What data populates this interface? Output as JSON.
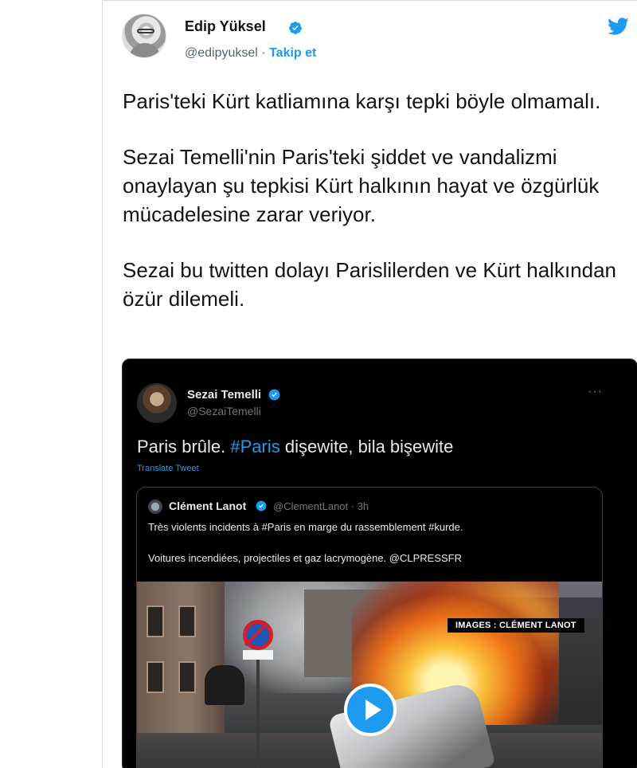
{
  "tweet": {
    "author_name": "Edip Yüksel",
    "handle": "@edipyuksel",
    "separator": "·",
    "follow_label": "Takip et",
    "paragraphs": [
      "Paris'teki Kürt katliamına karşı tepki böyle olmamalı.",
      "Sezai Temelli'nin Paris'teki şiddet ve vandalizmi onaylayan şu tepkisi Kürt halkının hayat ve özgürlük mücadelesine zarar veriyor.",
      "Sezai bu twitten dolayı Parislilerden ve Kürt halkından özür dilemeli."
    ]
  },
  "embedded_tweet": {
    "author_name": "Sezai Temelli",
    "handle": "@SezaiTemelli",
    "more_label": "···",
    "text_before": "Paris brûle. ",
    "hashtag": "#Paris",
    "text_after": " dişewite, bila bişewite",
    "translate_label": "Translate Tweet",
    "quoted": {
      "author_name": "Clément Lanot",
      "handle_time": "@ClementLanot · 3h",
      "line1": "Très violents incidents à #Paris en marge du rassemblement #kurde.",
      "line2": "Voitures incendiées, projectiles et gaz lacrymogène. @CLPRESSFR",
      "media_caption": "IMAGES : CLÉMENT LANOT"
    }
  },
  "colors": {
    "accent": "#1d9bf0",
    "text_primary": "#0f1419",
    "text_secondary": "#536471",
    "embed_bg": "#000000"
  },
  "icons": [
    "verified-badge-icon",
    "twitter-bird-icon",
    "play-icon",
    "more-icon"
  ]
}
